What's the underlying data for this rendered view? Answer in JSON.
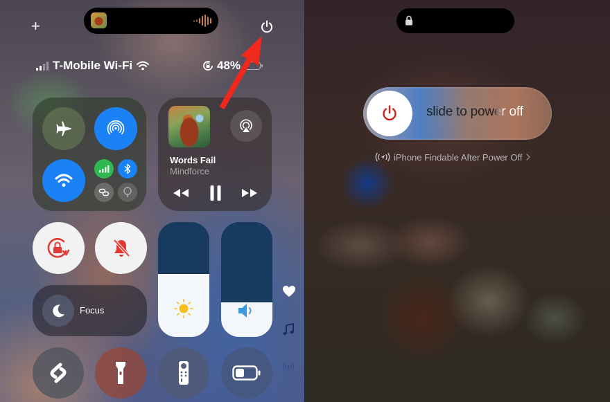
{
  "left_panel": {
    "dynamic_island": {
      "icon": "now-playing-artwork",
      "activity": "waveform-icon"
    },
    "top_controls": {
      "add_icon": "plus-icon",
      "power_icon": "power-icon"
    },
    "status_bar": {
      "carrier": "T-Mobile Wi-Fi",
      "signal_bars_active": 2,
      "signal_bars_total": 4,
      "battery_percent": "48%",
      "rotation_lock_icon": "rotation-lock-icon"
    },
    "connectivity": {
      "airplane_mode": {
        "icon": "airplane-icon",
        "on": false
      },
      "airdrop": {
        "icon": "airdrop-icon",
        "on": true
      },
      "wifi": {
        "icon": "wifi-icon",
        "on": true
      },
      "cellular": {
        "icon": "cellular-icon",
        "on": true
      },
      "bluetooth": {
        "icon": "bluetooth-icon",
        "on": true
      },
      "personal_hotspot": {
        "icon": "hotspot-icon",
        "on": false
      },
      "vpn": {
        "icon": "vpn-icon",
        "on": false
      }
    },
    "now_playing": {
      "title": "Words Fail",
      "artist": "Mindforce",
      "controls": [
        "rewind",
        "pause",
        "fast-forward"
      ]
    },
    "toggles": {
      "orientation_lock": {
        "icon": "rotation-lock-icon",
        "on": true
      },
      "silent_mode": {
        "icon": "bell-slash-icon",
        "on": true
      }
    },
    "focus": {
      "label": "Focus",
      "icon": "moon-icon"
    },
    "sliders": {
      "brightness": {
        "icon": "sun-icon",
        "level": 0.55
      },
      "volume": {
        "icon": "speaker-icon",
        "level": 0.3
      }
    },
    "side_indicators": [
      "heart-icon",
      "music-note-icon",
      "antenna-icon"
    ],
    "bottom_row": [
      {
        "name": "shazam",
        "icon": "shazam-icon"
      },
      {
        "name": "flashlight",
        "icon": "flashlight-icon"
      },
      {
        "name": "apple-tv-remote",
        "icon": "remote-icon"
      },
      {
        "name": "low-power-mode",
        "icon": "battery-icon"
      }
    ],
    "annotation": {
      "type": "arrow",
      "color": "#f0291c",
      "points_to": "power-icon"
    }
  },
  "right_panel": {
    "dynamic_island": {
      "icon": "lock-icon"
    },
    "power_slider": {
      "label": "slide to power off",
      "knob_icon": "power-icon",
      "knob_icon_color": "#d2221c"
    },
    "findable": {
      "label": "iPhone Findable After Power Off",
      "icon": "find-my-signal-icon",
      "chevron": "chevron-right-icon"
    }
  },
  "colors": {
    "accent_blue": "#1a82f5",
    "cellular_green": "#2fb84f",
    "toggle_red": "#e23b35",
    "arrow_red": "#f0291c"
  }
}
